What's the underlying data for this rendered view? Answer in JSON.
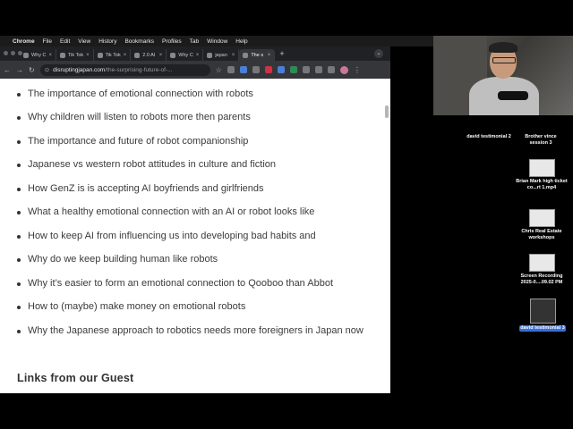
{
  "menubar": {
    "app": "Chrome",
    "items": [
      "File",
      "Edit",
      "View",
      "History",
      "Bookmarks",
      "Profiles",
      "Tab",
      "Window",
      "Help"
    ]
  },
  "tabs": [
    {
      "label": "Why C",
      "active": false
    },
    {
      "label": "Tik Tok",
      "active": false
    },
    {
      "label": "Tik Tok",
      "active": false
    },
    {
      "label": "2.0 AI",
      "active": false
    },
    {
      "label": "Why C",
      "active": false
    },
    {
      "label": "japan",
      "active": false
    },
    {
      "label": "The s",
      "active": true
    }
  ],
  "address": {
    "host": "disruptingjapan.com",
    "path": "/the-surprising-future-of-..."
  },
  "article": {
    "items": [
      "The importance of emotional connection with robots",
      "Why children will listen to robots more then parents",
      "The importance and future of robot companionship",
      "Japanese vs western robot attitudes in culture and fiction",
      "How GenZ is is accepting AI boyfriends and girlfriends",
      "What a healthy emotional connection with an AI or robot looks like",
      "How to keep AI from influencing us into developing bad habits and",
      "Why do we keep building human like robots",
      "Why it’s easier to form an emotional connection to Qooboo than Abbot",
      "How to (maybe) make money on emotional robots",
      "Why the Japanese approach to robotics needs more foreigners in Japan now"
    ],
    "section_title": "Links from our Guest"
  },
  "desktop": {
    "items": [
      {
        "label": "david testimonial 2"
      },
      {
        "label": "Brother vince session 3"
      },
      {
        "label": "Brian Mark high ticket co...rt 1.mp4"
      },
      {
        "label": "Chris Real Estate workshops"
      },
      {
        "label": "Screen Recording 2025-0....09.02 PM"
      },
      {
        "label": "david testimonial 3"
      }
    ]
  },
  "colors": {
    "accent": "#3b6fd6",
    "chrome_dark": "#35363a",
    "text": "#3b3b3b"
  }
}
